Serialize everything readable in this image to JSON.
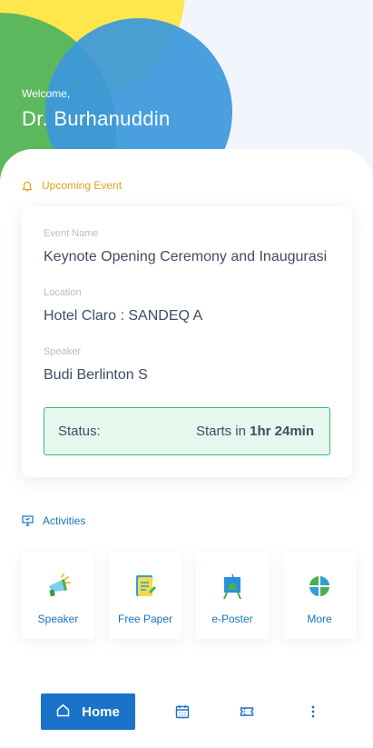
{
  "header": {
    "greeting": "Welcome,",
    "user_name": "Dr. Burhanuddin"
  },
  "upcoming": {
    "section_title": "Upcoming Event",
    "icon": "bell-icon",
    "event_name_label": "Event Name",
    "event_name": "Keynote Opening Ceremony and Inaugurasi",
    "location_label": "Location",
    "location": "Hotel Claro : SANDEQ A",
    "speaker_label": "Speaker",
    "speaker": "Budi Berlinton S",
    "status_label": "Status:",
    "status_prefix": "Starts in ",
    "status_time": "1hr 24min"
  },
  "activities": {
    "section_title": "Activities",
    "icon": "presentation-icon",
    "items": [
      {
        "label": "Speaker",
        "icon": "megaphone-icon"
      },
      {
        "label": "Free Paper",
        "icon": "paper-icon"
      },
      {
        "label": "e-Poster",
        "icon": "poster-board-icon"
      },
      {
        "label": "More",
        "icon": "grid-icon"
      }
    ]
  },
  "bottom_nav": {
    "home_label": "Home",
    "items": [
      "calendar-icon",
      "ticket-icon",
      "more-vertical-icon"
    ]
  },
  "colors": {
    "accent": "#1a73c8",
    "upcoming": "#e3a21a",
    "status_border": "#2fbf71",
    "status_bg": "#e6f8ee"
  }
}
